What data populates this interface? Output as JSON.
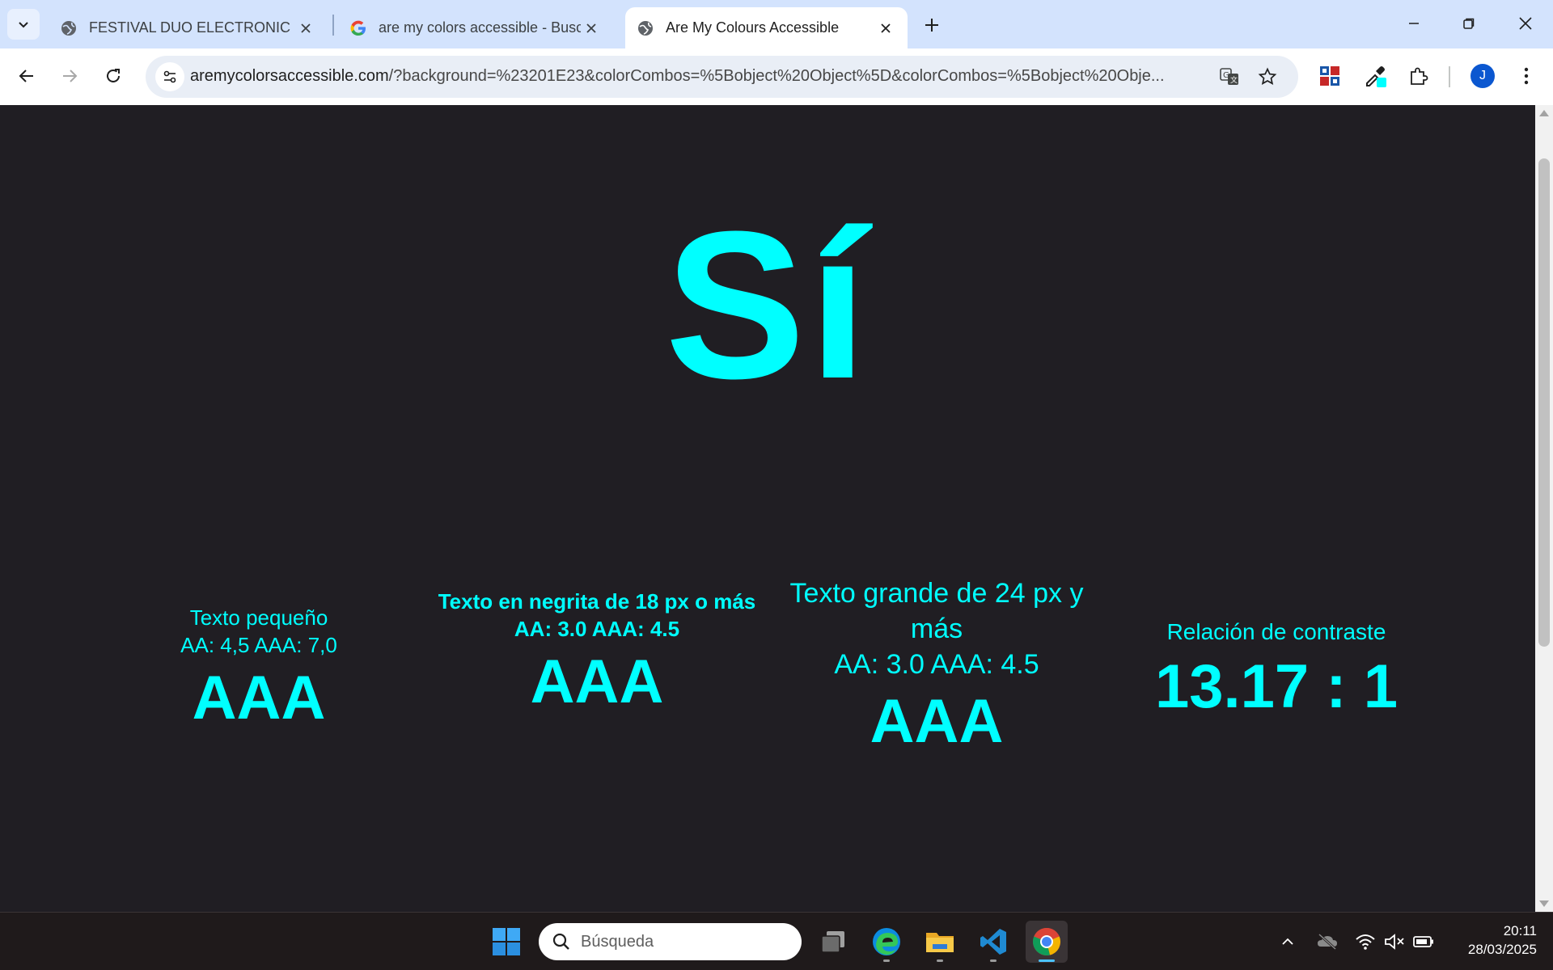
{
  "browser": {
    "tabs": [
      {
        "title": "FESTIVAL DUO ELECTRONIC",
        "favicon": "globe-icon",
        "active": false
      },
      {
        "title": "are my colors accessible - Busca",
        "favicon": "google-g-icon",
        "active": false
      },
      {
        "title": "Are My Colours Accessible",
        "favicon": "globe-icon",
        "active": true
      }
    ],
    "url_host": "aremycolorsaccessible.com",
    "url_rest": "/?background=%23201E23&colorCombos=%5Bobject%20Object%5D&colorCombos=%5Bobject%20Obje...",
    "profile_initial": "J"
  },
  "page": {
    "answer": "Sí",
    "small_text": {
      "label": "Texto pequeño",
      "thresholds": "AA: 4,5 AAA: 7,0",
      "result": "AAA"
    },
    "bold_text": {
      "label": "Texto en negrita de 18 px o más",
      "thresholds": "AA: 3.0 AAA: 4.5",
      "result": "AAA"
    },
    "large_text": {
      "label": "Texto grande de 24 px y más",
      "thresholds": "AA: 3.0 AAA: 4.5",
      "result": "AAA"
    },
    "contrast": {
      "label": "Relación de contraste",
      "value": "13.17 : 1"
    },
    "colors": {
      "background": "#201E23",
      "foreground": "#00FFFF"
    }
  },
  "taskbar": {
    "search_placeholder": "Búsqueda",
    "time": "20:11",
    "date": "28/03/2025",
    "apps": [
      "start-icon",
      "task-view-icon",
      "edge-icon",
      "file-explorer-icon",
      "vscode-icon",
      "chrome-icon"
    ]
  }
}
